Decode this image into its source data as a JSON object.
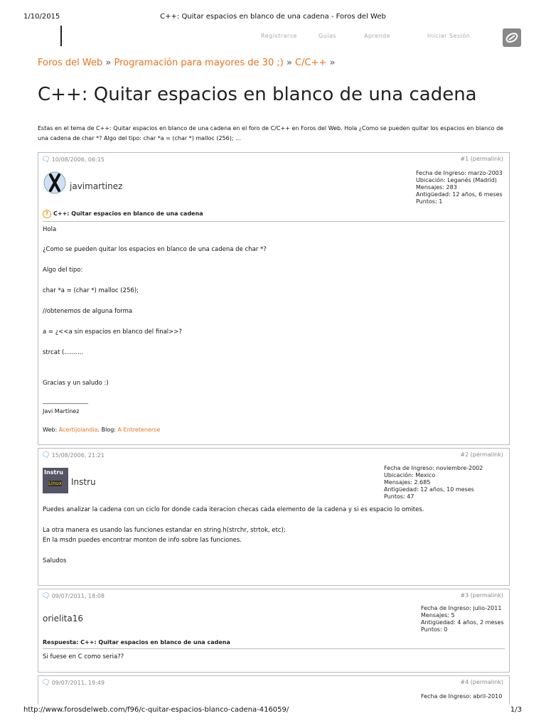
{
  "print": {
    "date": "1/10/2015",
    "title": "C++: Quitar espacios en blanco de una cadena - Foros del Web",
    "url": "http://www.forosdelweb.com/f96/c-quitar-espacios-blanco-cadena-416059/",
    "page": "1/3"
  },
  "nav": {
    "items": [
      "Registrarse",
      "Guías",
      "Aprende",
      "Iniciar Sesión"
    ]
  },
  "breadcrumb": {
    "items": [
      "Foros del Web",
      "Programación para mayores de 30 ;)",
      "C/C++"
    ],
    "separator": "»"
  },
  "page_title": "C++: Quitar espacios en blanco de una cadena",
  "intro": "Estas en el tema de C++: Quitar espacios en blanco de una cadena en el foro de C/C++ en Foros del Web. Hola ¿Como se pueden quitar los espacios en blanco de una cadena de char *? Algo del tipo: char *a = (char *) malloc (256); ...",
  "posts": [
    {
      "date": "10/08/2006, 06:15",
      "permalink": "#1 (permalink)",
      "user": "javimartinez",
      "info": [
        "Fecha de Ingreso: marzo-2003",
        "Ubicación: Leganés (Madrid)",
        "Mensajes: 283",
        "Antigüedad: 12 años, 6 meses",
        "Puntos: 1"
      ],
      "subject": "C++: Quitar espacios en blanco de una cadena",
      "body": [
        "Hola",
        "¿Como se pueden quitar los espacios en blanco de una cadena de char *?",
        "Algo del tipo:",
        "char *a = (char *) malloc (256);",
        "//obtenemos de alguna forma",
        "a = ¿<<a sin espacios en blanco del final>>?",
        "strcat (..........",
        "Gracias y un saludo :)"
      ],
      "sig_line": "________________",
      "sig_name": "Javi Martínez",
      "sig_web_label": "Web:",
      "sig_web_link": "Acertijolandia",
      "sig_blog_label": ". Blog:",
      "sig_blog_link": "A Entretenerse"
    },
    {
      "date": "15/08/2006, 21:21",
      "permalink": "#2 (permalink)",
      "user": "Instru",
      "avatar_text": [
        "Instru",
        "Linux"
      ],
      "info": [
        "Fecha de Ingreso: noviembre-2002",
        "Ubicación: Mexico",
        "Mensajes: 2.685",
        "Antigüedad: 12 años, 10 meses",
        "Puntos: 47"
      ],
      "body": [
        "Puedes analizar la cadena con un ciclo for donde cada iteracion checas cada elemento de la cadena y si es espacio lo omites.",
        "La otra manera es usando las funciones estandar en string.h(strchr, strtok, etc);",
        "En la msdn puedes encontrar monton de info sobre las funciones.",
        "Saludos"
      ]
    },
    {
      "date": "09/07/2011, 18:08",
      "permalink": "#3 (permalink)",
      "user": "orielita16",
      "info": [
        "Fecha de Ingreso: julio-2011",
        "Mensajes: 5",
        "Antigüedad: 4 años, 2 meses",
        "Puntos: 0"
      ],
      "subject": "Respuesta: C++: Quitar espacios en blanco de una cadena",
      "body": [
        "Si fuese en C como seria??"
      ]
    },
    {
      "date": "09/07/2011, 19:49",
      "permalink": "#4 (permalink)",
      "info": [
        "Fecha de Ingreso: abril-2010"
      ]
    }
  ],
  "colors": {
    "accent": "#e8731c",
    "border": "#bbbbbb",
    "bubble": "#3a8ac9"
  }
}
